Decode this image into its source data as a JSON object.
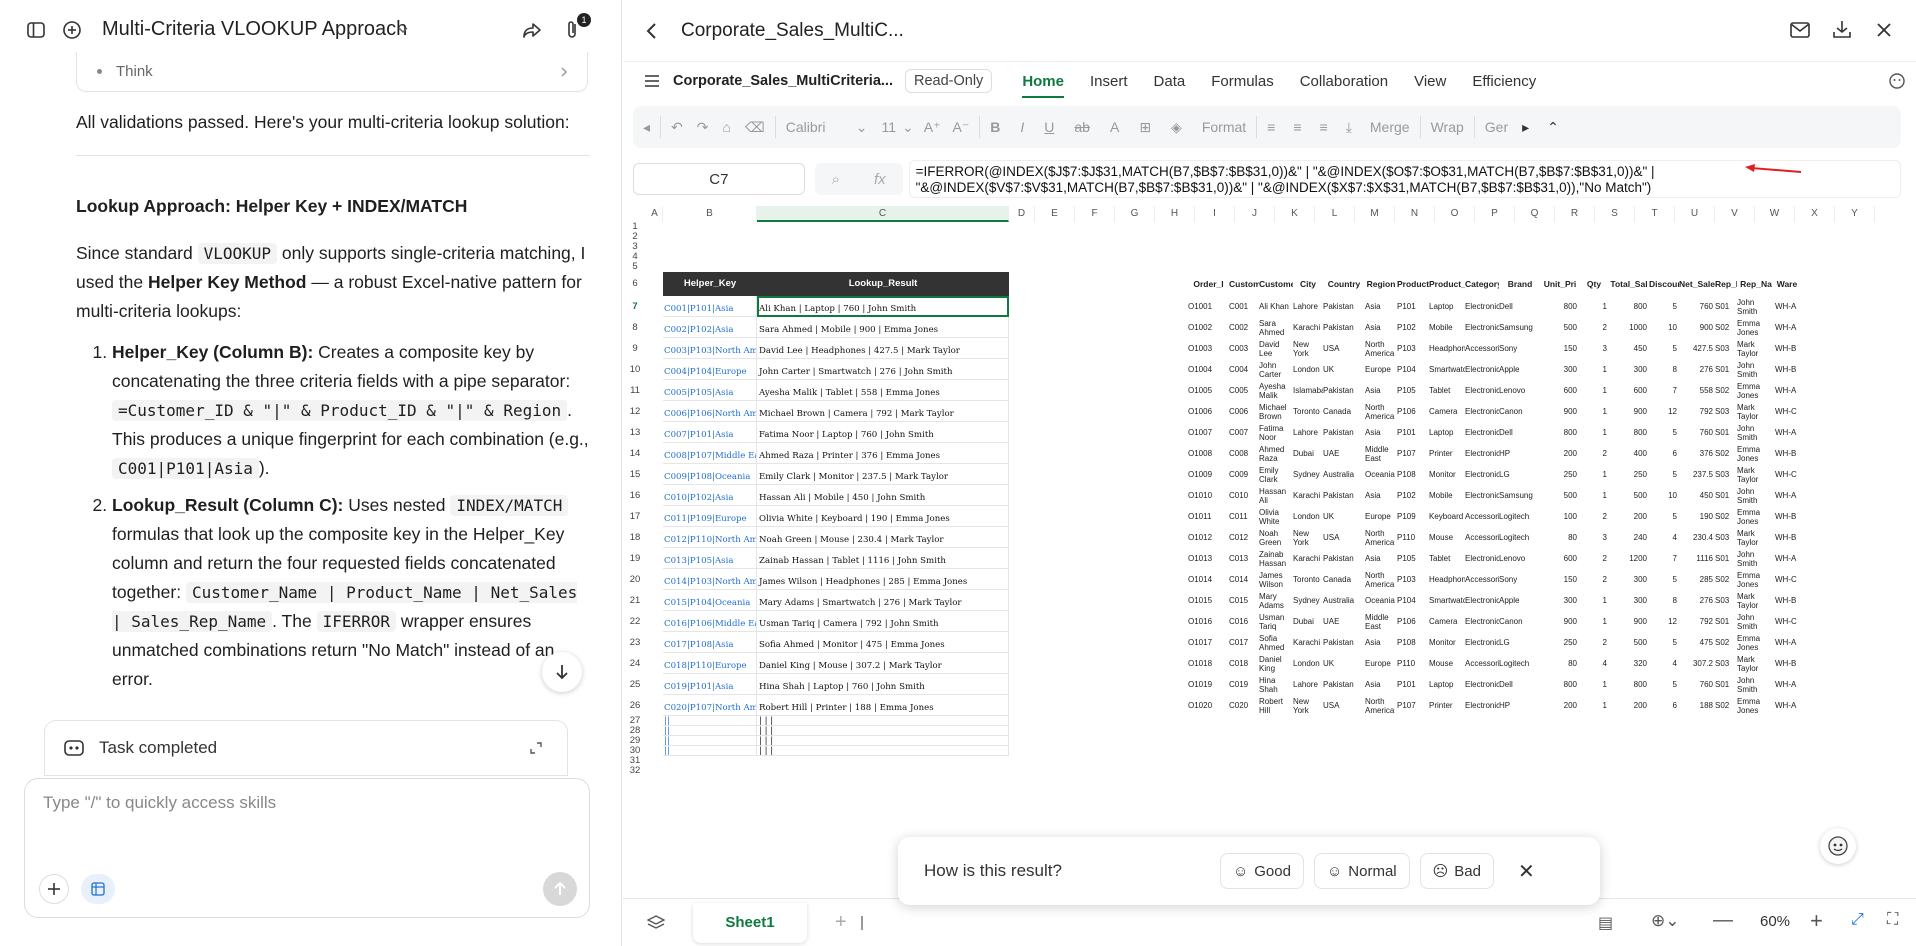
{
  "chat": {
    "title": "Multi-Criteria VLOOKUP Approach",
    "attachment_badge": "1",
    "think_label": "Think",
    "intro": "All validations passed. Here's your multi-criteria lookup solution:",
    "heading": "Lookup Approach: Helper Key + INDEX/MATCH",
    "p1_a": "Since standard ",
    "p1_code": "VLOOKUP",
    "p1_b": " only supports single-criteria matching, I used the ",
    "p1_bold": "Helper Key Method",
    "p1_c": " — a robust Excel-native pattern for multi-criteria lookups:",
    "step1_bold": "Helper_Key (Column B):",
    "step1_a": " Creates a composite key by concatenating the three criteria fields with a pipe separator: ",
    "step1_code": "=Customer_ID & \"|\" & Product_ID & \"|\" & Region",
    "step1_b": ". This produces a unique fingerprint for each combination (e.g., ",
    "step1_code2": "C001|P101|Asia",
    "step1_c": ").",
    "step2_bold": "Lookup_Result (Column C):",
    "step2_a": " Uses nested ",
    "step2_code": "INDEX/MATCH",
    "step2_b": " formulas that look up the composite key in the Helper_Key column and return the four requested fields concatenated together: ",
    "step2_code2": "Customer_Name | Product_Name | Net_Sales | Sales_Rep_Name",
    "step2_c": ". The ",
    "step2_code3": "IFERROR",
    "step2_d": " wrapper ensures unmatched combinations return \"No Match\" instead of an error.",
    "task_completed": "Task completed",
    "input_placeholder": "Type \"/\" to quickly access skills"
  },
  "sheet": {
    "window_title": "Corporate_Sales_MultiC...",
    "doc_name": "Corporate_Sales_MultiCriteria...",
    "read_only": "Read-Only",
    "tabs": [
      "Home",
      "Insert",
      "Data",
      "Formulas",
      "Collaboration",
      "View",
      "Efficiency"
    ],
    "toolbar": {
      "font": "Calibri",
      "size": "11",
      "format": "Format",
      "merge": "Merge",
      "wrap": "Wrap",
      "general": "Ger"
    },
    "name_box": "C7",
    "formula": "=IFERROR(@INDEX($J$7:$J$31,MATCH(B7,$B$7:$B$31,0))&\" | \"&@INDEX($O$7:$O$31,MATCH(B7,$B$7:$B$31,0))&\" | \"&@INDEX($V$7:$V$31,MATCH(B7,$B$7:$B$31,0))&\" | \"&@INDEX($X$7:$X$31,MATCH(B7,$B$7:$B$31,0)),\"No Match\")",
    "columns": [
      "A",
      "B",
      "C",
      "D",
      "E",
      "F",
      "G",
      "H",
      "I",
      "J",
      "K",
      "L",
      "M",
      "N",
      "O",
      "P",
      "Q",
      "R",
      "S",
      "T",
      "U",
      "V",
      "W",
      "X",
      "Y"
    ],
    "rows": [
      "1",
      "2",
      "3",
      "4",
      "5",
      "6",
      "7",
      "8",
      "9",
      "10",
      "11",
      "12",
      "13",
      "14",
      "15",
      "16",
      "17",
      "18",
      "19",
      "20",
      "21",
      "22",
      "23",
      "24",
      "25",
      "26",
      "27",
      "28",
      "29",
      "30",
      "31",
      "32"
    ],
    "left_headers": [
      "Helper_Key",
      "Lookup_Result"
    ],
    "left_rows": [
      [
        "C001|P101|Asia",
        "Ali Khan | Laptop | 760 | John Smith"
      ],
      [
        "C002|P102|Asia",
        "Sara Ahmed | Mobile | 900 | Emma Jones"
      ],
      [
        "C003|P103|North Amer",
        "David Lee | Headphones | 427.5 | Mark Taylor"
      ],
      [
        "C004|P104|Europe",
        "John Carter | Smartwatch | 276 | John Smith"
      ],
      [
        "C005|P105|Asia",
        "Ayesha Malik | Tablet | 558 | Emma Jones"
      ],
      [
        "C006|P106|North Amer",
        "Michael Brown | Camera | 792 | Mark Taylor"
      ],
      [
        "C007|P101|Asia",
        "Fatima Noor | Laptop | 760 | John Smith"
      ],
      [
        "C008|P107|Middle East",
        "Ahmed Raza | Printer | 376 | Emma Jones"
      ],
      [
        "C009|P108|Oceania",
        "Emily Clark | Monitor | 237.5 | Mark Taylor"
      ],
      [
        "C010|P102|Asia",
        "Hassan Ali | Mobile | 450 | John Smith"
      ],
      [
        "C011|P109|Europe",
        "Olivia White | Keyboard | 190 | Emma Jones"
      ],
      [
        "C012|P110|North Amer",
        "Noah Green | Mouse | 230.4 | Mark Taylor"
      ],
      [
        "C013|P105|Asia",
        "Zainab Hassan | Tablet | 1116 | John Smith"
      ],
      [
        "C014|P103|North Amer",
        "James Wilson | Headphones | 285 | Emma Jones"
      ],
      [
        "C015|P104|Oceania",
        "Mary Adams | Smartwatch | 276 | Mark Taylor"
      ],
      [
        "C016|P106|Middle East",
        "Usman Tariq | Camera | 792 | John Smith"
      ],
      [
        "C017|P108|Asia",
        "Sofia Ahmed | Monitor | 475 | Emma Jones"
      ],
      [
        "C018|P110|Europe",
        "Daniel King | Mouse | 307.2 | Mark Taylor"
      ],
      [
        "C019|P101|Asia",
        "Hina Shah | Laptop | 760 | John Smith"
      ],
      [
        "C020|P107|North Amer",
        "Robert Hill | Printer | 188 | Emma Jones"
      ],
      [
        "||",
        "| | |"
      ],
      [
        "||",
        "| | |"
      ],
      [
        "||",
        "| | |"
      ],
      [
        "||",
        "| | |"
      ]
    ],
    "right_headers": [
      "Order_I",
      "Custome",
      "Custome",
      "City",
      "Country",
      "Region",
      "Product_",
      "Product_",
      "Category",
      "Brand",
      "Unit_Pri",
      "Qty",
      "Total_Sal",
      "Discount",
      "Net_Sale",
      "Rep_ID",
      "Rep_Na",
      "Ware"
    ],
    "right_rows": [
      [
        "O1001",
        "C001",
        "Ali Khan",
        "Lahore",
        "Pakistan",
        "Asia",
        "P101",
        "Laptop",
        "Electronics",
        "Dell",
        "800",
        "1",
        "800",
        "5",
        "760",
        "S01",
        "John Smith",
        "WH-A"
      ],
      [
        "O1002",
        "C002",
        "Sara Ahmed",
        "Karachi",
        "Pakistan",
        "Asia",
        "P102",
        "Mobile",
        "Electronics",
        "Samsung",
        "500",
        "2",
        "1000",
        "10",
        "900",
        "S02",
        "Emma Jones",
        "WH-A"
      ],
      [
        "O1003",
        "C003",
        "David Lee",
        "New York",
        "USA",
        "North America",
        "P103",
        "Headphones",
        "Accessories",
        "Sony",
        "150",
        "3",
        "450",
        "5",
        "427.5",
        "S03",
        "Mark Taylor",
        "WH-B"
      ],
      [
        "O1004",
        "C004",
        "John Carter",
        "London",
        "UK",
        "Europe",
        "P104",
        "Smartwatch",
        "Electronics",
        "Apple",
        "300",
        "1",
        "300",
        "8",
        "276",
        "S01",
        "John Smith",
        "WH-B"
      ],
      [
        "O1005",
        "C005",
        "Ayesha Malik",
        "Islamabad",
        "Pakistan",
        "Asia",
        "P105",
        "Tablet",
        "Electronics",
        "Lenovo",
        "600",
        "1",
        "600",
        "7",
        "558",
        "S02",
        "Emma Jones",
        "WH-A"
      ],
      [
        "O1006",
        "C006",
        "Michael Brown",
        "Toronto",
        "Canada",
        "North America",
        "P106",
        "Camera",
        "Electronics",
        "Canon",
        "900",
        "1",
        "900",
        "12",
        "792",
        "S03",
        "Mark Taylor",
        "WH-C"
      ],
      [
        "O1007",
        "C007",
        "Fatima Noor",
        "Lahore",
        "Pakistan",
        "Asia",
        "P101",
        "Laptop",
        "Electronics",
        "Dell",
        "800",
        "1",
        "800",
        "5",
        "760",
        "S01",
        "John Smith",
        "WH-A"
      ],
      [
        "O1008",
        "C008",
        "Ahmed Raza",
        "Dubai",
        "UAE",
        "Middle East",
        "P107",
        "Printer",
        "Electronics",
        "HP",
        "200",
        "2",
        "400",
        "6",
        "376",
        "S02",
        "Emma Jones",
        "WH-B"
      ],
      [
        "O1009",
        "C009",
        "Emily Clark",
        "Sydney",
        "Australia",
        "Oceania",
        "P108",
        "Monitor",
        "Electronics",
        "LG",
        "250",
        "1",
        "250",
        "5",
        "237.5",
        "S03",
        "Mark Taylor",
        "WH-C"
      ],
      [
        "O1010",
        "C010",
        "Hassan Ali",
        "Karachi",
        "Pakistan",
        "Asia",
        "P102",
        "Mobile",
        "Electronics",
        "Samsung",
        "500",
        "1",
        "500",
        "10",
        "450",
        "S01",
        "John Smith",
        "WH-A"
      ],
      [
        "O1011",
        "C011",
        "Olivia White",
        "London",
        "UK",
        "Europe",
        "P109",
        "Keyboard",
        "Accessories",
        "Logitech",
        "100",
        "2",
        "200",
        "5",
        "190",
        "S02",
        "Emma Jones",
        "WH-B"
      ],
      [
        "O1012",
        "C012",
        "Noah Green",
        "New York",
        "USA",
        "North America",
        "P110",
        "Mouse",
        "Accessories",
        "Logitech",
        "80",
        "3",
        "240",
        "4",
        "230.4",
        "S03",
        "Mark Taylor",
        "WH-B"
      ],
      [
        "O1013",
        "C013",
        "Zainab Hassan",
        "Karachi",
        "Pakistan",
        "Asia",
        "P105",
        "Tablet",
        "Electronics",
        "Lenovo",
        "600",
        "2",
        "1200",
        "7",
        "1116",
        "S01",
        "John Smith",
        "WH-A"
      ],
      [
        "O1014",
        "C014",
        "James Wilson",
        "Toronto",
        "Canada",
        "North America",
        "P103",
        "Headphones",
        "Accessories",
        "Sony",
        "150",
        "2",
        "300",
        "5",
        "285",
        "S02",
        "Emma Jones",
        "WH-C"
      ],
      [
        "O1015",
        "C015",
        "Mary Adams",
        "Sydney",
        "Australia",
        "Oceania",
        "P104",
        "Smartwatch",
        "Electronics",
        "Apple",
        "300",
        "1",
        "300",
        "8",
        "276",
        "S03",
        "Mark Taylor",
        "WH-B"
      ],
      [
        "O1016",
        "C016",
        "Usman Tariq",
        "Dubai",
        "UAE",
        "Middle East",
        "P106",
        "Camera",
        "Electronics",
        "Canon",
        "900",
        "1",
        "900",
        "12",
        "792",
        "S01",
        "John Smith",
        "WH-C"
      ],
      [
        "O1017",
        "C017",
        "Sofia Ahmed",
        "Karachi",
        "Pakistan",
        "Asia",
        "P108",
        "Monitor",
        "Electronics",
        "LG",
        "250",
        "2",
        "500",
        "5",
        "475",
        "S02",
        "Emma Jones",
        "WH-A"
      ],
      [
        "O1018",
        "C018",
        "Daniel King",
        "London",
        "UK",
        "Europe",
        "P110",
        "Mouse",
        "Accessories",
        "Logitech",
        "80",
        "4",
        "320",
        "4",
        "307.2",
        "S03",
        "Mark Taylor",
        "WH-B"
      ],
      [
        "O1019",
        "C019",
        "Hina Shah",
        "Lahore",
        "Pakistan",
        "Asia",
        "P101",
        "Laptop",
        "Electronics",
        "Dell",
        "800",
        "1",
        "800",
        "5",
        "760",
        "S01",
        "John Smith",
        "WH-A"
      ],
      [
        "O1020",
        "C020",
        "Robert Hill",
        "New York",
        "USA",
        "North America",
        "P107",
        "Printer",
        "Electronics",
        "HP",
        "200",
        "1",
        "200",
        "6",
        "188",
        "S02",
        "Emma Jones",
        "WH-A"
      ]
    ],
    "sheet_tab": "Sheet1",
    "zoom": "60%"
  },
  "feedback": {
    "question": "How is this result?",
    "good": "Good",
    "normal": "Normal",
    "bad": "Bad"
  },
  "colors": {
    "accent": "#0f7a3f",
    "link": "#1f6fd1",
    "arrow": "#e02020"
  }
}
